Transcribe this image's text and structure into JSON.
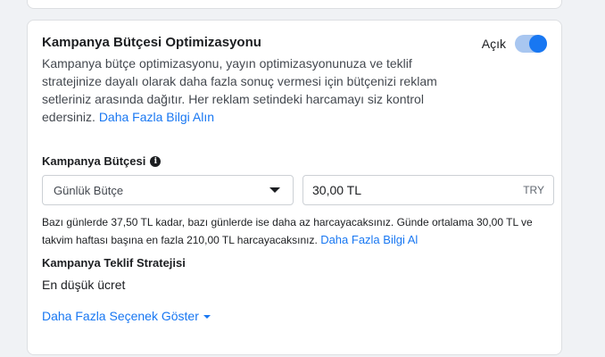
{
  "cbo": {
    "title": "Kampanya Bütçesi Optimizasyonu",
    "toggle_label": "Açık",
    "description": "Kampanya bütçe optimizasyonu, yayın optimizasyonunuza ve teklif stratejinize dayalı olarak daha fazla sonuç vermesi için bütçenizi reklam setleriniz arasında dağıtır. Her reklam setindeki harcamayı siz kontrol edersiniz.",
    "learn_more": "Daha Fazla Bilgi Alın"
  },
  "budget": {
    "label": "Kampanya Bütçesi",
    "info_icon": "i",
    "type_selected": "Günlük Bütçe",
    "amount": "30,00 TL",
    "currency": "TRY",
    "note": "Bazı günlerde 37,50 TL kadar, bazı günlerde ise daha az harcayacaksınız. Günde ortalama 30,00 TL ve takvim haftası başına en fazla 210,00 TL harcayacaksınız.",
    "note_link": "Daha Fazla Bilgi Al"
  },
  "bid": {
    "label": "Kampanya Teklif Stratejisi",
    "value": "En düşük ücret"
  },
  "more_options": "Daha Fazla Seçenek Göster",
  "colors": {
    "accent": "#1877f2",
    "toggle_track": "#a8c6f0",
    "background": "#f0f2f5"
  }
}
